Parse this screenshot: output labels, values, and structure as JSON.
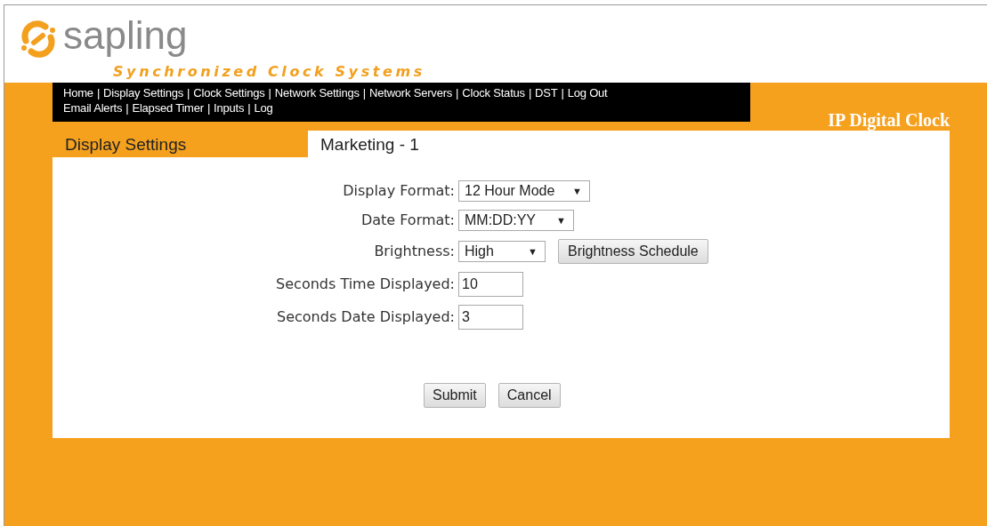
{
  "logo": {
    "name": "sapling",
    "tagline": "Synchronized Clock Systems"
  },
  "nav": [
    {
      "links": [
        {
          "label": "Home",
          "separator": "|"
        },
        {
          "label": "Display Settings",
          "separator": "|"
        },
        {
          "label": "Clock Settings",
          "separator": "|"
        },
        {
          "label": "Network Settings",
          "separator": "|"
        },
        {
          "label": "Network Servers",
          "separator": "|"
        },
        {
          "label": "Clock Status",
          "separator": "|"
        },
        {
          "label": "DST",
          "separator": "|"
        },
        {
          "label": "Log Out"
        }
      ]
    },
    {
      "links": [
        {
          "label": "Email Alerts",
          "separator": "|"
        },
        {
          "label": "Elapsed Timer",
          "separator": "|"
        },
        {
          "label": "Inputs",
          "separator": "|"
        },
        {
          "label": "Log"
        }
      ]
    }
  ],
  "product": "IP Digital Clock",
  "tabs": [
    {
      "label": "Display Settings",
      "selected": false
    },
    {
      "label": "Marketing - 1",
      "selected": true
    }
  ],
  "form": [
    {
      "kind": "select",
      "label": "Display Format:",
      "value": "12 Hour Mode",
      "arrow": "▼"
    },
    {
      "kind": "select",
      "label": "Date Format:",
      "value": "MM:DD:YY",
      "arrow": "▼"
    },
    {
      "kind": "select",
      "label": "Brightness:",
      "value": "High",
      "arrow": "▼",
      "button": "Brightness Schedule"
    },
    {
      "kind": "input",
      "label": "Seconds Time Displayed:",
      "value": "10"
    },
    {
      "kind": "input",
      "label": "Seconds Date Displayed:",
      "value": "3"
    }
  ],
  "buttons": [
    "Submit",
    "Cancel"
  ]
}
